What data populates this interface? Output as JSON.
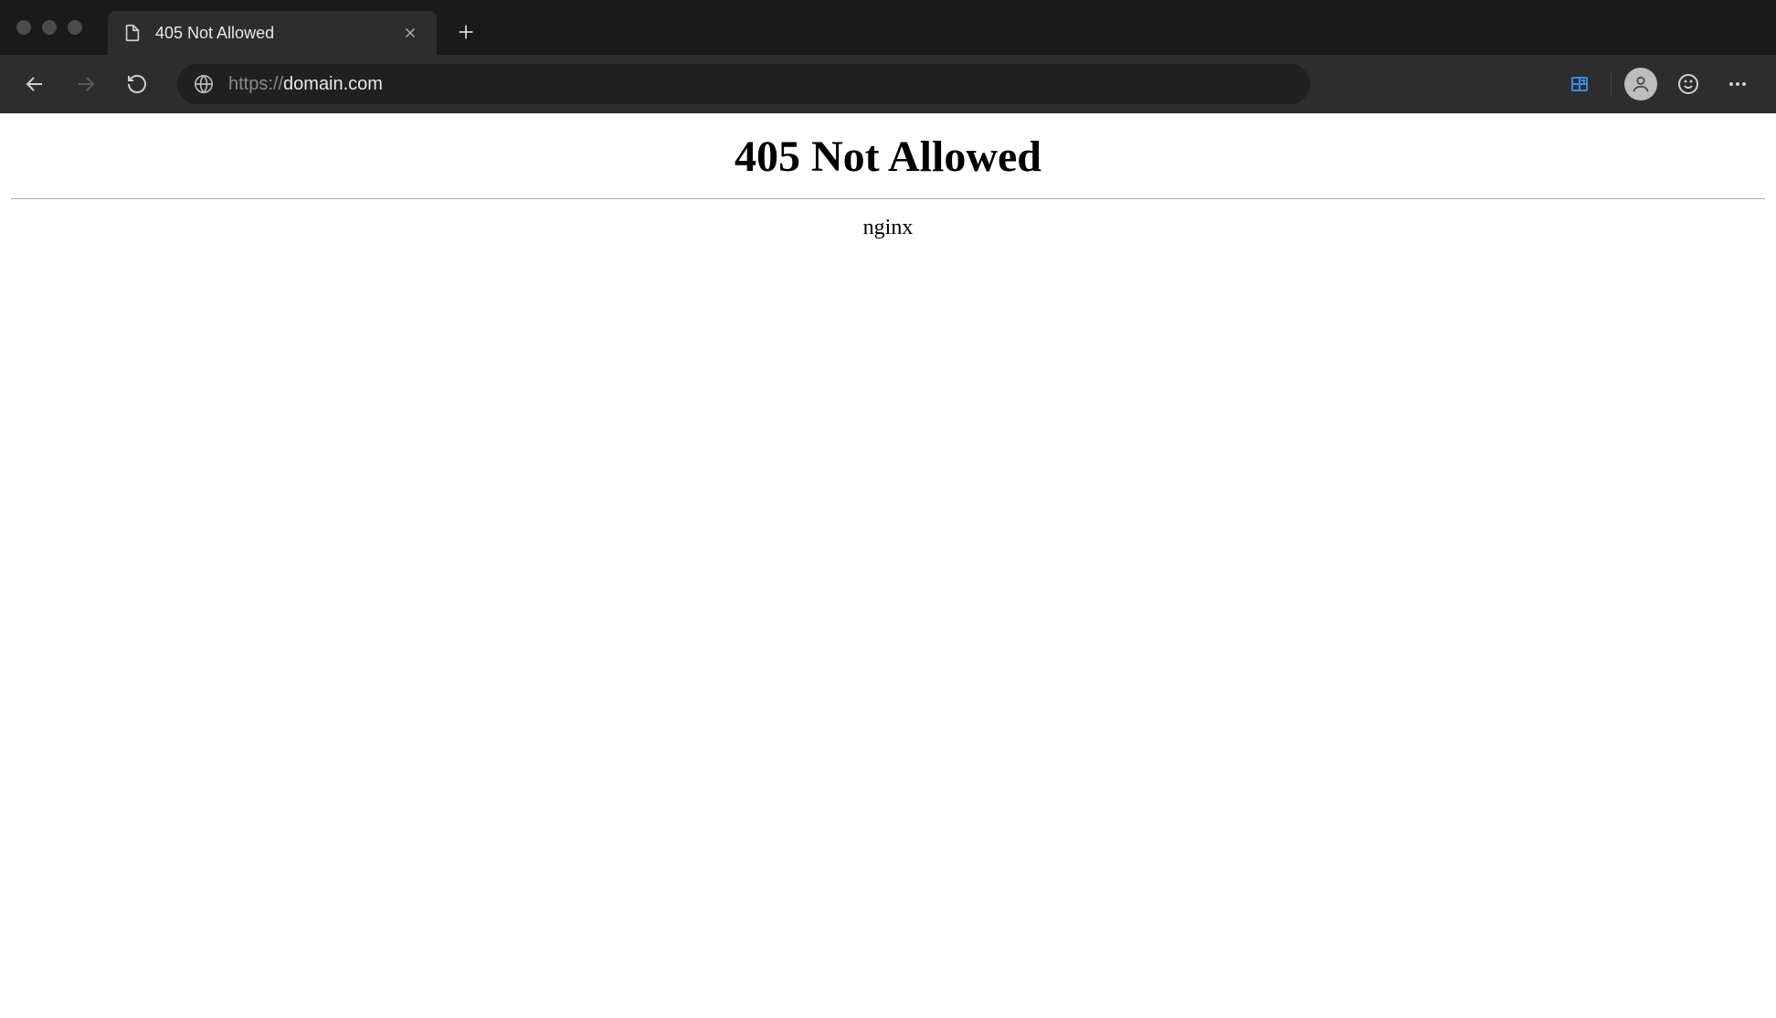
{
  "browser": {
    "tab": {
      "title": "405 Not Allowed"
    },
    "addressBar": {
      "protocol": "https://",
      "host": "domain.com"
    }
  },
  "page": {
    "heading": "405 Not Allowed",
    "server": "nginx"
  }
}
